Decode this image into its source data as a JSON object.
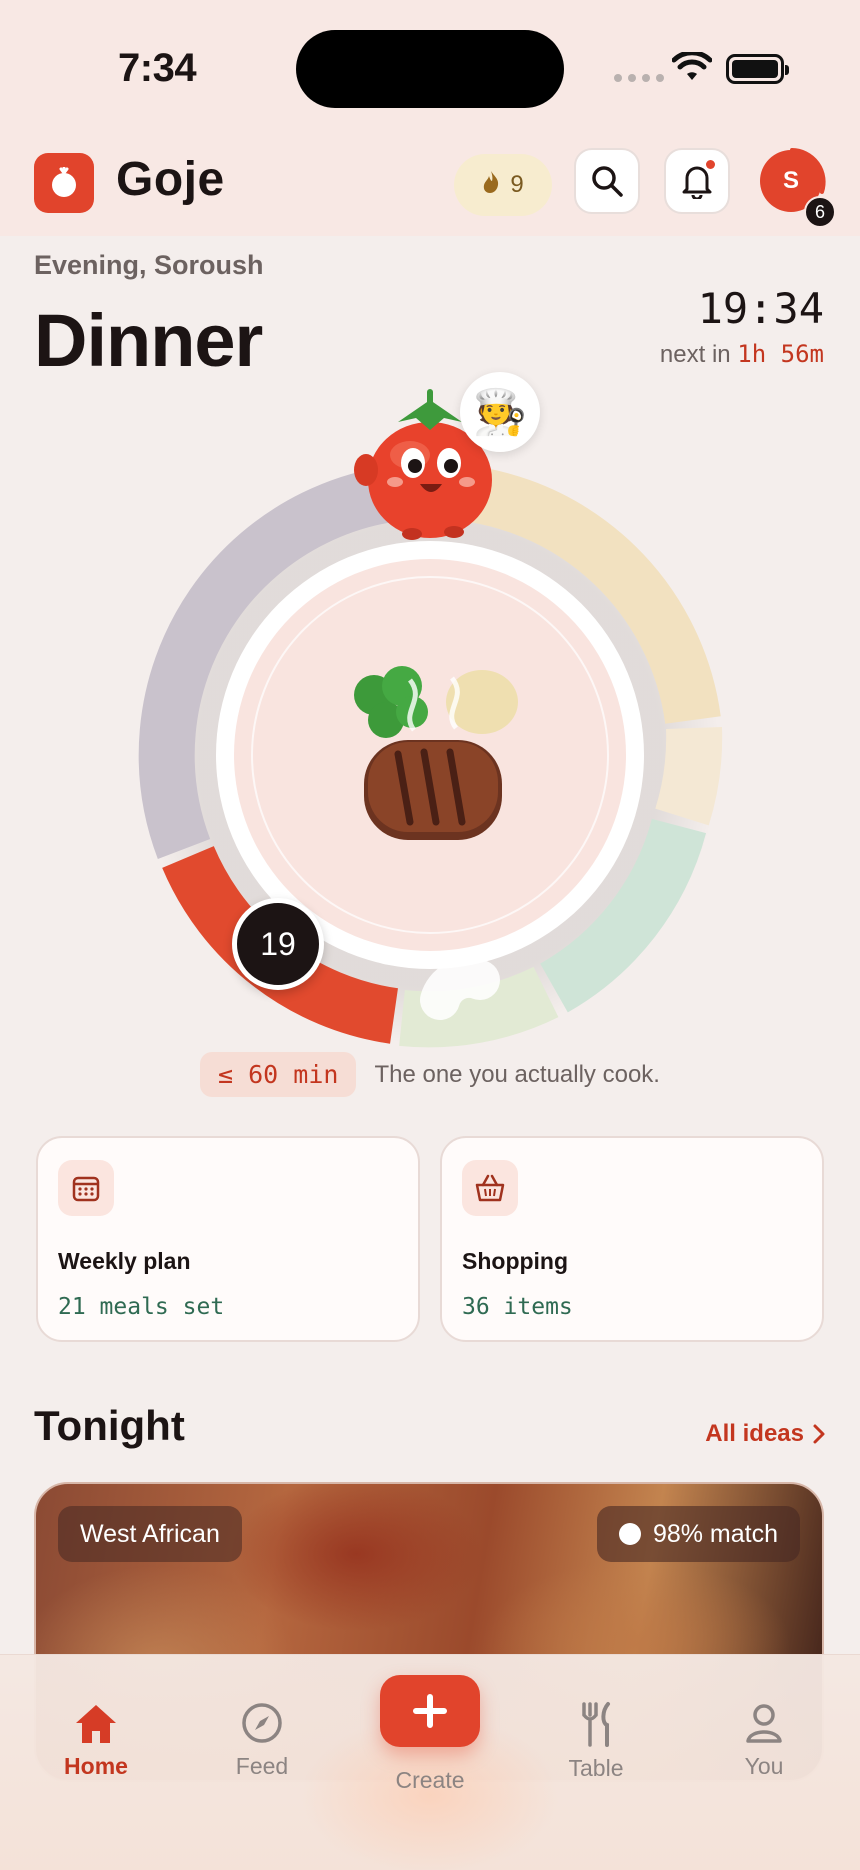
{
  "status_bar": {
    "time": "7:34"
  },
  "header": {
    "brand": "Goje",
    "streak_count": "9",
    "avatar_initial": "S",
    "avatar_badge": "6"
  },
  "hero": {
    "greeting": "Evening, Soroush",
    "meal": "Dinner",
    "clock": "19:34",
    "next_prefix": "next in",
    "next_value": "1h 56m",
    "current_hour": "19",
    "chef_emoji": "🧑‍🍳"
  },
  "caption": {
    "chip": "≤ 60 min",
    "text": "The one you actually cook."
  },
  "cards": [
    {
      "title": "Weekly plan",
      "subtitle": "21 meals set",
      "icon": "calendar-icon"
    },
    {
      "title": "Shopping",
      "subtitle": "36 items",
      "icon": "basket-icon"
    }
  ],
  "tonight": {
    "title": "Tonight",
    "all_ideas": "All ideas",
    "cuisine": "West African",
    "match": "98% match"
  },
  "tabs": {
    "home": "Home",
    "feed": "Feed",
    "create": "Create",
    "table": "Table",
    "you": "You"
  },
  "colors": {
    "accent": "#e1442c",
    "accent_text": "#c3361f",
    "mono_green": "#2f6a52",
    "background": "#f4eeec"
  }
}
